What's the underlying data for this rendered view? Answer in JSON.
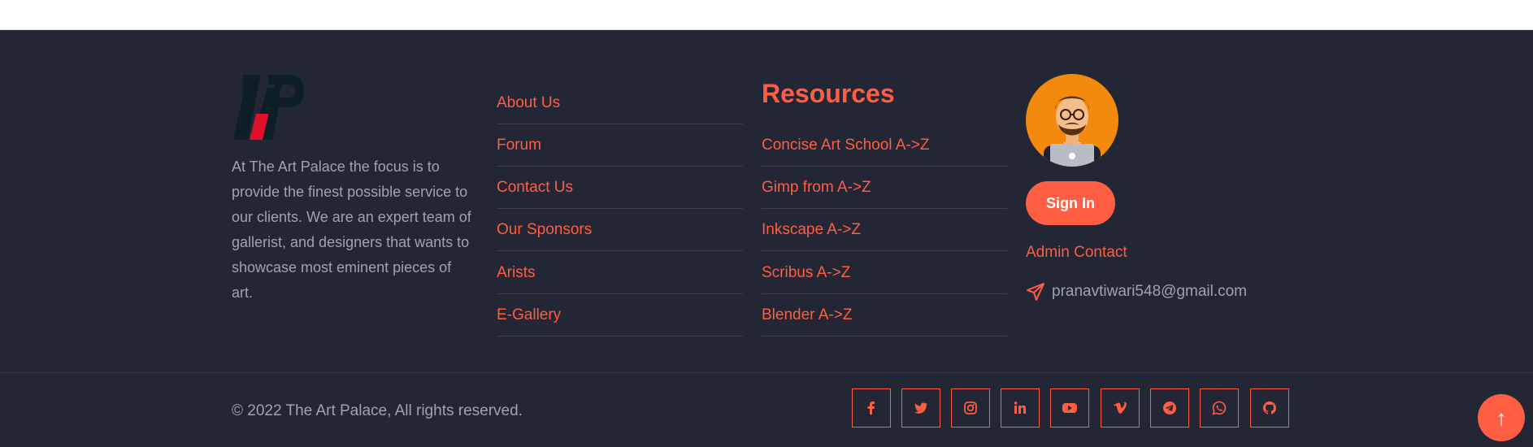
{
  "about": {
    "logo_alt": "TAP",
    "description": "At The Art Palace the focus is to provide the finest possible service to our clients. We are an expert team of gallerist, and designers that wants to showcase most eminent pieces of art."
  },
  "links": {
    "items": [
      {
        "label": "About Us"
      },
      {
        "label": "Forum"
      },
      {
        "label": "Contact Us"
      },
      {
        "label": "Our Sponsors"
      },
      {
        "label": "Arists"
      },
      {
        "label": "E-Gallery"
      }
    ]
  },
  "resources": {
    "heading": "Resources",
    "items": [
      {
        "label": "Concise Art School A->Z"
      },
      {
        "label": "Gimp from A->Z"
      },
      {
        "label": "Inkscape A->Z"
      },
      {
        "label": "Scribus A->Z"
      },
      {
        "label": "Blender A->Z"
      }
    ]
  },
  "profile": {
    "signin_label": "Sign In",
    "admin_contact": "Admin Contact",
    "email": "pranavtiwari548@gmail.com"
  },
  "bottom": {
    "copyright": "© 2022 The Art Palace, All rights reserved.",
    "social": [
      {
        "icon": "facebook-icon"
      },
      {
        "icon": "twitter-icon"
      },
      {
        "icon": "instagram-icon"
      },
      {
        "icon": "linkedin-icon"
      },
      {
        "icon": "youtube-icon"
      },
      {
        "icon": "vimeo-icon"
      },
      {
        "icon": "telegram-icon"
      },
      {
        "icon": "whatsapp-icon"
      },
      {
        "icon": "github-icon"
      }
    ],
    "to_top_label": "↑"
  },
  "colors": {
    "accent": "#ff5e43",
    "footer_bg": "#232634",
    "muted_text": "#a1a3ab",
    "avatar_bg": "#f38a0e"
  }
}
